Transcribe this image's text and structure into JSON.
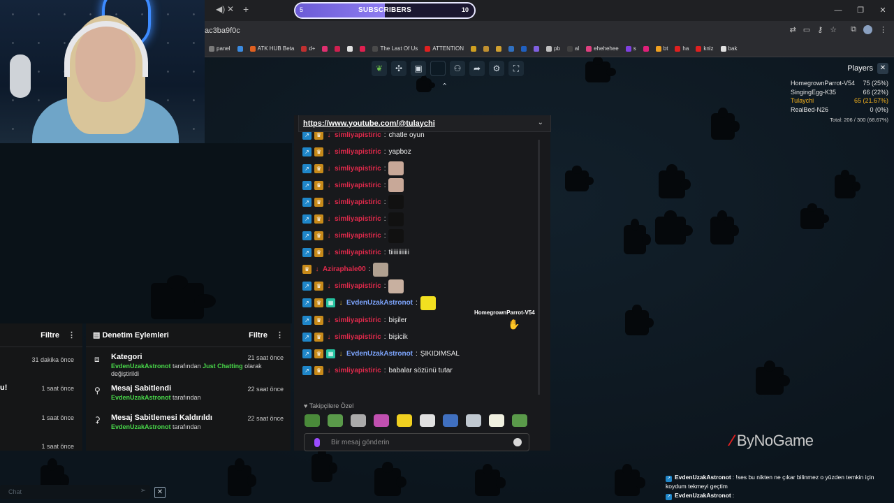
{
  "subscriber_goal": {
    "label": "SUBSCRIBERS",
    "current": "5",
    "target": "10",
    "progress": 0.5
  },
  "address": {
    "url": "ac3ba9f0c"
  },
  "bookmarks": [
    "panel",
    "",
    "ATK HUB Beta",
    "d+",
    "",
    "",
    "",
    "",
    "The Last Of Us",
    "ATTENTION",
    "",
    "",
    "",
    "",
    "",
    "",
    "pb",
    "al",
    "ehehehee",
    "s",
    "",
    "bt",
    "ha",
    "knlz",
    "bak"
  ],
  "players": {
    "title": "Players",
    "rows": [
      {
        "name": "HomegrownParrot-V54",
        "score": "75 (25%)"
      },
      {
        "name": "SingingEgg-K35",
        "score": "66 (22%)"
      },
      {
        "name": "Tulaychi",
        "score": "65 (21.67%)"
      },
      {
        "name": "RealBed-N26",
        "score": "0 (0%)"
      }
    ],
    "total": "Total: 206 / 300 (68.67%)"
  },
  "cursor_label": "HomegrownParrot-V54",
  "chat": {
    "pinned": "https://www.youtube.com/@tulaychi",
    "messages": [
      {
        "user": "simliyapistiric",
        "text": "chatle oyun"
      },
      {
        "user": "simliyapistiric",
        "text": "yapboz"
      },
      {
        "user": "simliyapistiric",
        "text": ""
      },
      {
        "user": "simliyapistiric",
        "text": ""
      },
      {
        "user": "simliyapistiric",
        "text": ""
      },
      {
        "user": "simliyapistiric",
        "text": ""
      },
      {
        "user": "simliyapistiric",
        "text": ""
      },
      {
        "user": "simliyapistiric",
        "text": "tiiiiiiiiiiii"
      },
      {
        "user": "Aziraphale00",
        "text": ""
      },
      {
        "user": "simliyapistiric",
        "text": ""
      },
      {
        "user": "EvdenUzakAstronot",
        "text": ""
      },
      {
        "user": "simliyapistiric",
        "text": "bişiler"
      },
      {
        "user": "simliyapistiric",
        "text": "bişicik"
      },
      {
        "user": "EvdenUzakAstronot",
        "text": "ŞIKIDIMSAL"
      },
      {
        "user": "simliyapistiric",
        "text": "babalar sözünü tutar"
      }
    ],
    "followers_only": "Takipçilere Özel",
    "input_placeholder": "Bir mesaj gönderin"
  },
  "mod_left": {
    "filter": "Filtre",
    "times": [
      "31 dakika önce",
      "1 saat önce",
      "1 saat önce",
      "1 saat önce"
    ],
    "cut_label": "u!"
  },
  "mod_right": {
    "title": "Denetim Eylemleri",
    "filter": "Filtre",
    "items": [
      {
        "title": "Kategori",
        "user": "EvdenUzakAstronot",
        "pre": "tarafından",
        "game": "Just Chatting",
        "post": "olarak değiştirildi",
        "time": "21 saat önce"
      },
      {
        "title": "Mesaj Sabitlendi",
        "user": "EvdenUzakAstronot",
        "pre": "tarafından",
        "time": "22 saat önce"
      },
      {
        "title": "Mesaj Sabitlemesi Kaldırıldı",
        "user": "EvdenUzakAstronot",
        "pre": "tarafından",
        "time": "22 saat önce"
      }
    ]
  },
  "bottom_chat": {
    "placeholder": "Chat"
  },
  "logo": {
    "text": "ByNoGame"
  },
  "overlay_chat": [
    {
      "user": "EvdenUzakAstronot",
      "text": ": !ses bu nikten ne çıkar bilinmez o yüzden temkin için koydum tekmeyi geçtim"
    },
    {
      "user": "EvdenUzakAstronot",
      "text": ":"
    }
  ]
}
